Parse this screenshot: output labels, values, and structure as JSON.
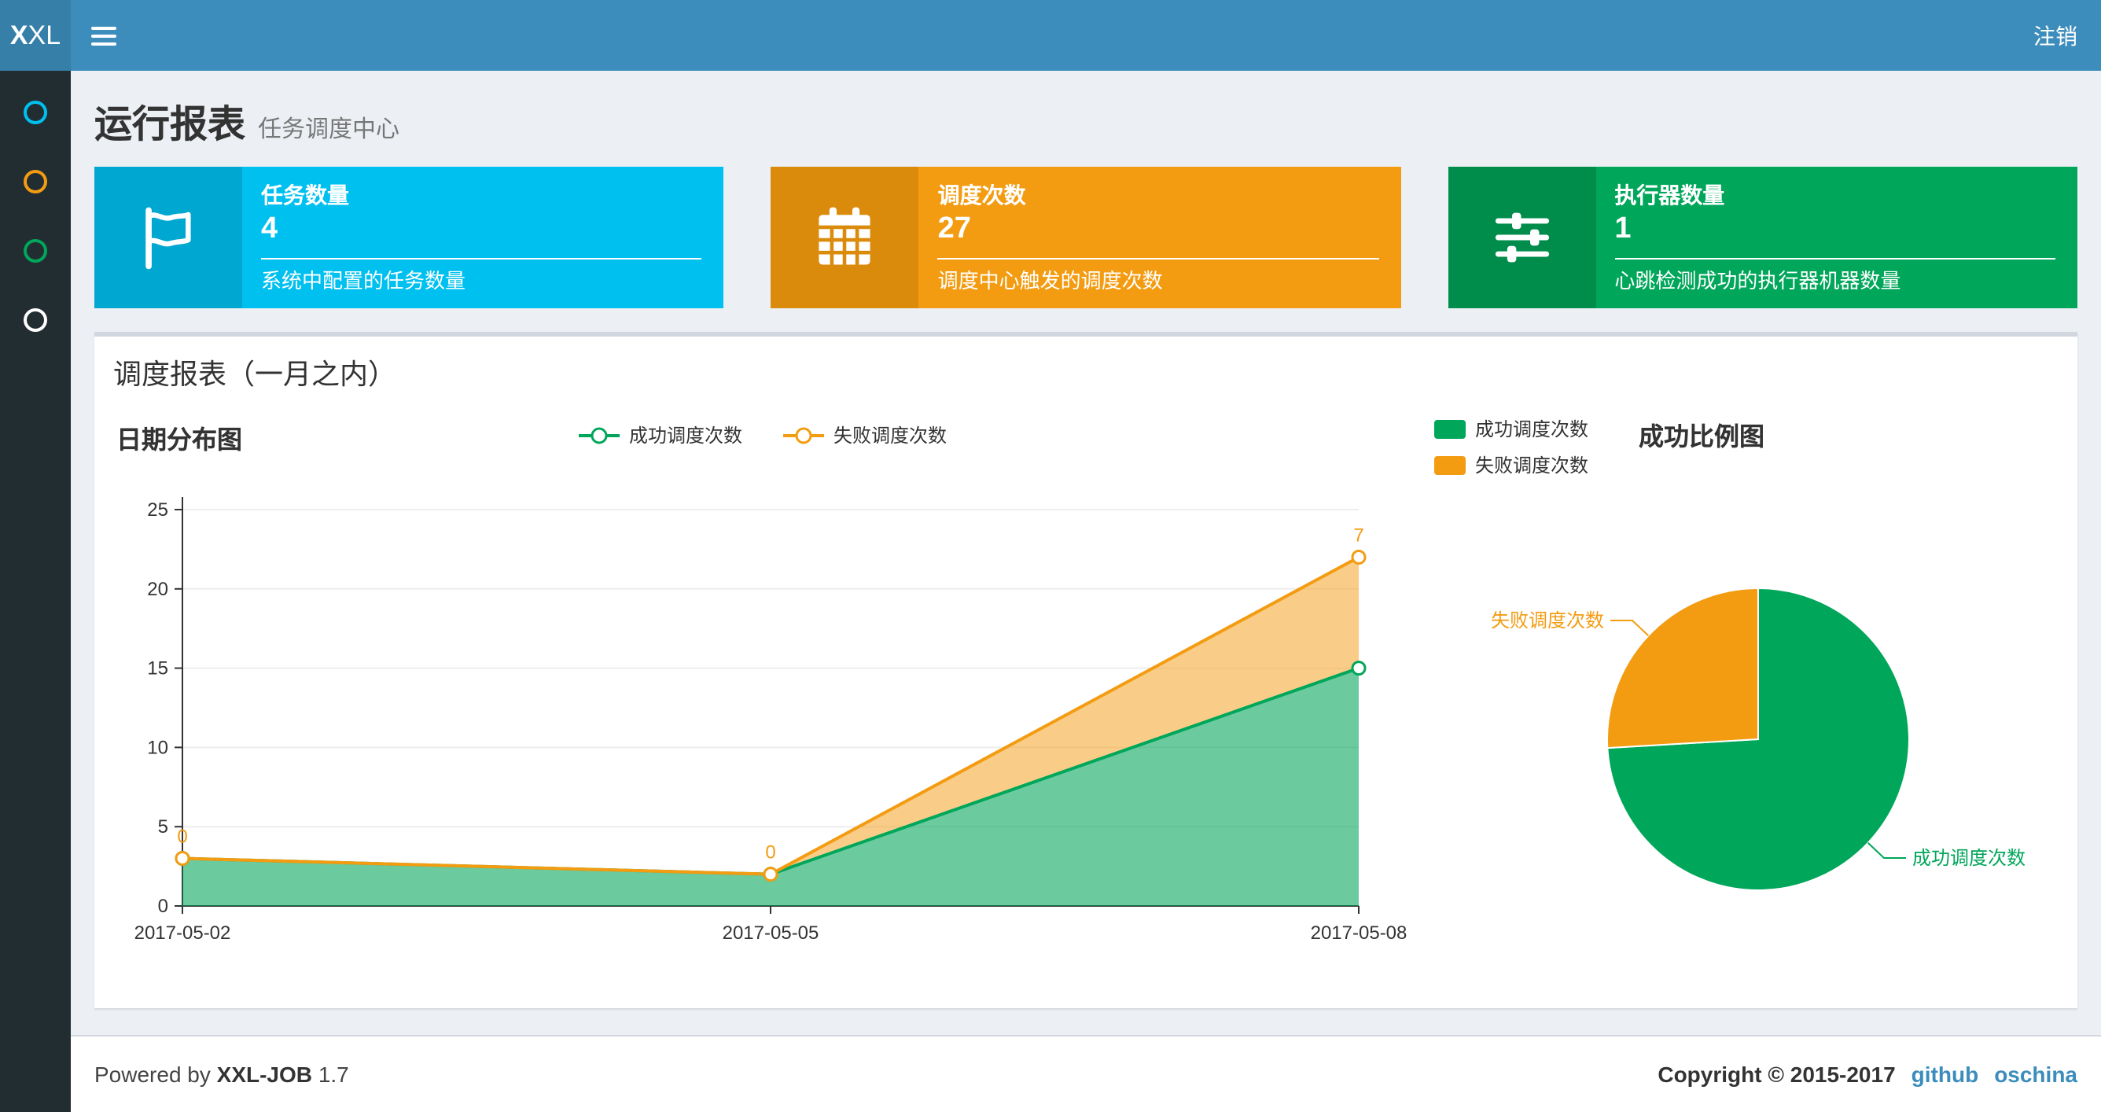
{
  "theme": {
    "navbar": "#3c8dbc",
    "logo_bg": "#367fa9",
    "sidebar_bg": "#222d32",
    "content_bg": "#ecf0f5",
    "link": "#3c8dbc"
  },
  "navbar": {
    "logo_bold": "X",
    "logo_rest": "XL",
    "logout_label": "注销"
  },
  "sidebar": {
    "items": [
      {
        "icon": "circle-o-icon",
        "color": "#00c0ef"
      },
      {
        "icon": "circle-o-icon",
        "color": "#f39c12"
      },
      {
        "icon": "circle-o-icon",
        "color": "#00a65a"
      },
      {
        "icon": "circle-o-icon",
        "color": "#ffffff"
      }
    ]
  },
  "header": {
    "title": "运行报表",
    "subtitle": "任务调度中心"
  },
  "info_boxes": [
    {
      "label": "任务数量",
      "value": "4",
      "desc": "系统中配置的任务数量",
      "color": "#00c0ef",
      "icon_color": "#00a7d0",
      "icon": "flag-icon"
    },
    {
      "label": "调度次数",
      "value": "27",
      "desc": "调度中心触发的调度次数",
      "color": "#f39c12",
      "icon_color": "#db8b0b",
      "icon": "calendar-icon"
    },
    {
      "label": "执行器数量",
      "value": "1",
      "desc": "心跳检测成功的执行器机器数量",
      "color": "#00a65a",
      "icon_color": "#008d4c",
      "icon": "sliders-icon"
    }
  ],
  "panel": {
    "title": "调度报表（一月之内）"
  },
  "chart_data": [
    {
      "type": "area",
      "title": "日期分布图",
      "categories": [
        "2017-05-02",
        "2017-05-05",
        "2017-05-08"
      ],
      "series": [
        {
          "name": "成功调度次数",
          "color": "#00A65A",
          "values": [
            3,
            2,
            15
          ]
        },
        {
          "name": "失败调度次数",
          "color": "#F39C12",
          "values": [
            0,
            0,
            7
          ],
          "labels": [
            "0",
            "0",
            "7"
          ]
        }
      ],
      "stacked": true,
      "ylim": [
        0,
        25
      ],
      "yticks": [
        0,
        5,
        10,
        15,
        20,
        25
      ],
      "legend_position": "top",
      "grid": true
    },
    {
      "type": "pie",
      "title": "成功比例图",
      "slices": [
        {
          "name": "成功调度次数",
          "value": 20,
          "color": "#00A65A"
        },
        {
          "name": "失败调度次数",
          "value": 7,
          "color": "#F39C12"
        }
      ],
      "legend_position": "top-left"
    }
  ],
  "footer": {
    "powered_prefix": "Powered by",
    "product": "XXL-JOB",
    "version": "1.7",
    "copyright": "Copyright © 2015-2017",
    "links": [
      {
        "label": "github"
      },
      {
        "label": "oschina"
      }
    ]
  }
}
